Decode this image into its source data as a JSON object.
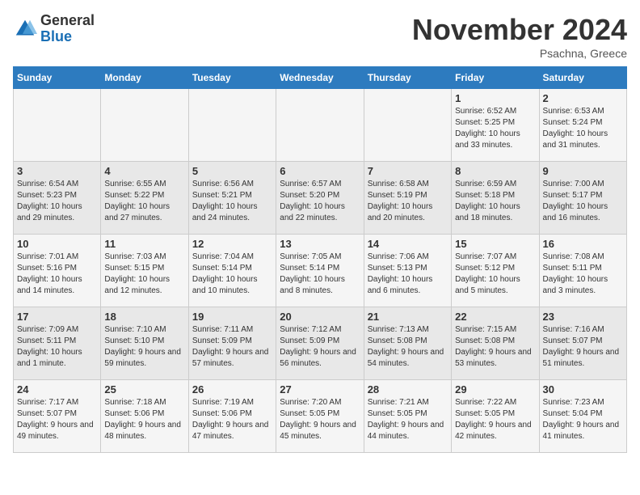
{
  "header": {
    "logo_general": "General",
    "logo_blue": "Blue",
    "month_title": "November 2024",
    "location": "Psachna, Greece"
  },
  "days_of_week": [
    "Sunday",
    "Monday",
    "Tuesday",
    "Wednesday",
    "Thursday",
    "Friday",
    "Saturday"
  ],
  "weeks": [
    [
      {
        "day": "",
        "info": ""
      },
      {
        "day": "",
        "info": ""
      },
      {
        "day": "",
        "info": ""
      },
      {
        "day": "",
        "info": ""
      },
      {
        "day": "",
        "info": ""
      },
      {
        "day": "1",
        "info": "Sunrise: 6:52 AM\nSunset: 5:25 PM\nDaylight: 10 hours\nand 33 minutes."
      },
      {
        "day": "2",
        "info": "Sunrise: 6:53 AM\nSunset: 5:24 PM\nDaylight: 10 hours\nand 31 minutes."
      }
    ],
    [
      {
        "day": "3",
        "info": "Sunrise: 6:54 AM\nSunset: 5:23 PM\nDaylight: 10 hours\nand 29 minutes."
      },
      {
        "day": "4",
        "info": "Sunrise: 6:55 AM\nSunset: 5:22 PM\nDaylight: 10 hours\nand 27 minutes."
      },
      {
        "day": "5",
        "info": "Sunrise: 6:56 AM\nSunset: 5:21 PM\nDaylight: 10 hours\nand 24 minutes."
      },
      {
        "day": "6",
        "info": "Sunrise: 6:57 AM\nSunset: 5:20 PM\nDaylight: 10 hours\nand 22 minutes."
      },
      {
        "day": "7",
        "info": "Sunrise: 6:58 AM\nSunset: 5:19 PM\nDaylight: 10 hours\nand 20 minutes."
      },
      {
        "day": "8",
        "info": "Sunrise: 6:59 AM\nSunset: 5:18 PM\nDaylight: 10 hours\nand 18 minutes."
      },
      {
        "day": "9",
        "info": "Sunrise: 7:00 AM\nSunset: 5:17 PM\nDaylight: 10 hours\nand 16 minutes."
      }
    ],
    [
      {
        "day": "10",
        "info": "Sunrise: 7:01 AM\nSunset: 5:16 PM\nDaylight: 10 hours\nand 14 minutes."
      },
      {
        "day": "11",
        "info": "Sunrise: 7:03 AM\nSunset: 5:15 PM\nDaylight: 10 hours\nand 12 minutes."
      },
      {
        "day": "12",
        "info": "Sunrise: 7:04 AM\nSunset: 5:14 PM\nDaylight: 10 hours\nand 10 minutes."
      },
      {
        "day": "13",
        "info": "Sunrise: 7:05 AM\nSunset: 5:14 PM\nDaylight: 10 hours\nand 8 minutes."
      },
      {
        "day": "14",
        "info": "Sunrise: 7:06 AM\nSunset: 5:13 PM\nDaylight: 10 hours\nand 6 minutes."
      },
      {
        "day": "15",
        "info": "Sunrise: 7:07 AM\nSunset: 5:12 PM\nDaylight: 10 hours\nand 5 minutes."
      },
      {
        "day": "16",
        "info": "Sunrise: 7:08 AM\nSunset: 5:11 PM\nDaylight: 10 hours\nand 3 minutes."
      }
    ],
    [
      {
        "day": "17",
        "info": "Sunrise: 7:09 AM\nSunset: 5:11 PM\nDaylight: 10 hours\nand 1 minute."
      },
      {
        "day": "18",
        "info": "Sunrise: 7:10 AM\nSunset: 5:10 PM\nDaylight: 9 hours\nand 59 minutes."
      },
      {
        "day": "19",
        "info": "Sunrise: 7:11 AM\nSunset: 5:09 PM\nDaylight: 9 hours\nand 57 minutes."
      },
      {
        "day": "20",
        "info": "Sunrise: 7:12 AM\nSunset: 5:09 PM\nDaylight: 9 hours\nand 56 minutes."
      },
      {
        "day": "21",
        "info": "Sunrise: 7:13 AM\nSunset: 5:08 PM\nDaylight: 9 hours\nand 54 minutes."
      },
      {
        "day": "22",
        "info": "Sunrise: 7:15 AM\nSunset: 5:08 PM\nDaylight: 9 hours\nand 53 minutes."
      },
      {
        "day": "23",
        "info": "Sunrise: 7:16 AM\nSunset: 5:07 PM\nDaylight: 9 hours\nand 51 minutes."
      }
    ],
    [
      {
        "day": "24",
        "info": "Sunrise: 7:17 AM\nSunset: 5:07 PM\nDaylight: 9 hours\nand 49 minutes."
      },
      {
        "day": "25",
        "info": "Sunrise: 7:18 AM\nSunset: 5:06 PM\nDaylight: 9 hours\nand 48 minutes."
      },
      {
        "day": "26",
        "info": "Sunrise: 7:19 AM\nSunset: 5:06 PM\nDaylight: 9 hours\nand 47 minutes."
      },
      {
        "day": "27",
        "info": "Sunrise: 7:20 AM\nSunset: 5:05 PM\nDaylight: 9 hours\nand 45 minutes."
      },
      {
        "day": "28",
        "info": "Sunrise: 7:21 AM\nSunset: 5:05 PM\nDaylight: 9 hours\nand 44 minutes."
      },
      {
        "day": "29",
        "info": "Sunrise: 7:22 AM\nSunset: 5:05 PM\nDaylight: 9 hours\nand 42 minutes."
      },
      {
        "day": "30",
        "info": "Sunrise: 7:23 AM\nSunset: 5:04 PM\nDaylight: 9 hours\nand 41 minutes."
      }
    ]
  ]
}
